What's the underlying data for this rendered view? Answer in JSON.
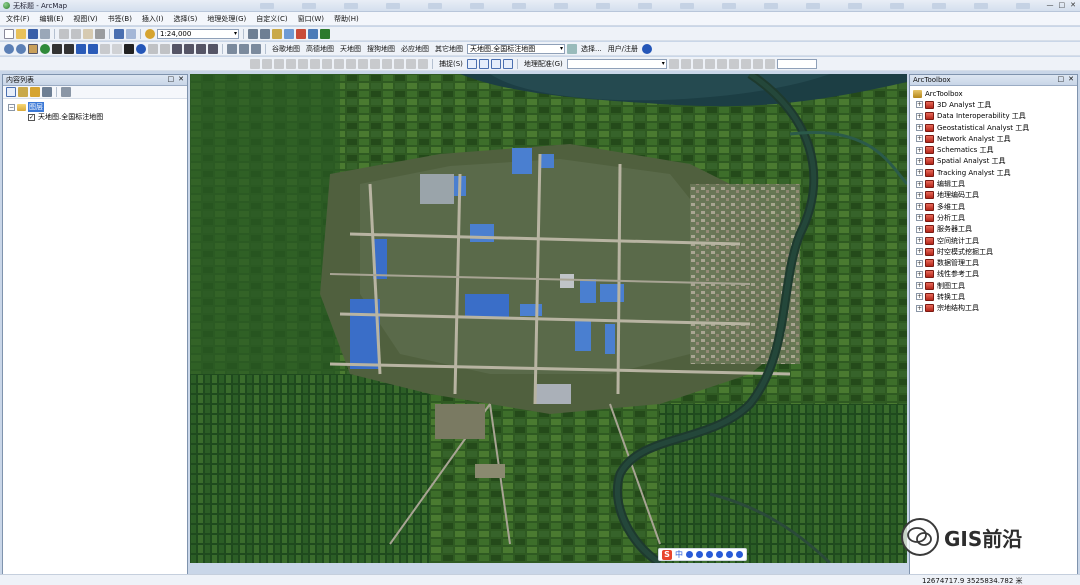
{
  "window": {
    "title": "无标题 - ArcMap",
    "controls": [
      "—",
      "□",
      "✕"
    ]
  },
  "menubar": [
    "文件(F)",
    "编辑(E)",
    "视图(V)",
    "书签(B)",
    "插入(I)",
    "选择(S)",
    "地理处理(G)",
    "自定义(C)",
    "窗口(W)",
    "帮助(H)"
  ],
  "toolbar1": {
    "scale": "1:24,000"
  },
  "toolbar2": {
    "basemaps": [
      "谷歌地图",
      "高德地图",
      "天地图",
      "搜狗地图",
      "必应地图",
      "其它地图"
    ],
    "basemap_select": "天地图.全国标注地图",
    "select_label": "选择...",
    "user_label": "用户/注册"
  },
  "toolbar3": {
    "snapping": "捕捉(S)",
    "georef": "地理配准(G)"
  },
  "toc": {
    "title": "内容列表",
    "layers_label": "图层",
    "layer_name": "天地图.全国标注地图"
  },
  "toolbox": {
    "panel_title": "ArcToolbox",
    "root": "ArcToolbox",
    "items": [
      "3D Analyst 工具",
      "Data Interoperability 工具",
      "Geostatistical Analyst 工具",
      "Network Analyst 工具",
      "Schematics 工具",
      "Spatial Analyst 工具",
      "Tracking Analyst 工具",
      "编辑工具",
      "地理编码工具",
      "多维工具",
      "分析工具",
      "服务器工具",
      "空间统计工具",
      "时空模式挖掘工具",
      "数据管理工具",
      "线性参考工具",
      "制图工具",
      "转换工具",
      "宗地结构工具"
    ]
  },
  "status": {
    "coordinates": "12674717.9  3525834.782 米"
  },
  "ime": {
    "logo": "S",
    "lang": "中"
  },
  "watermark": {
    "text": "GIS前沿"
  }
}
